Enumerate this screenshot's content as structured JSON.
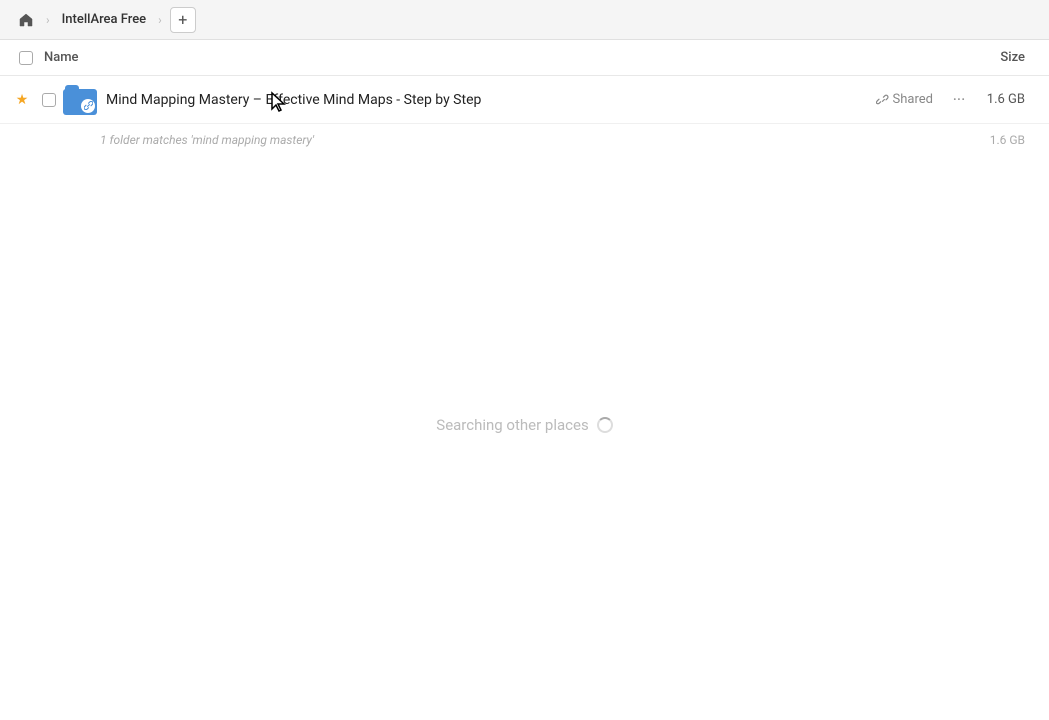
{
  "topbar": {
    "home_icon": "🏠",
    "breadcrumb_app": "IntellArea Free",
    "add_btn_label": "+"
  },
  "columns": {
    "name_label": "Name",
    "size_label": "Size"
  },
  "file_row": {
    "name": "Mind Mapping Mastery – Effective Mind Maps - Step by Step",
    "shared_label": "Shared",
    "more_icon": "···",
    "size": "1.6 GB",
    "star_filled": "★"
  },
  "match_info": {
    "text": "1 folder matches 'mind mapping mastery'",
    "size": "1.6 GB"
  },
  "searching": {
    "text": "Searching other places"
  }
}
